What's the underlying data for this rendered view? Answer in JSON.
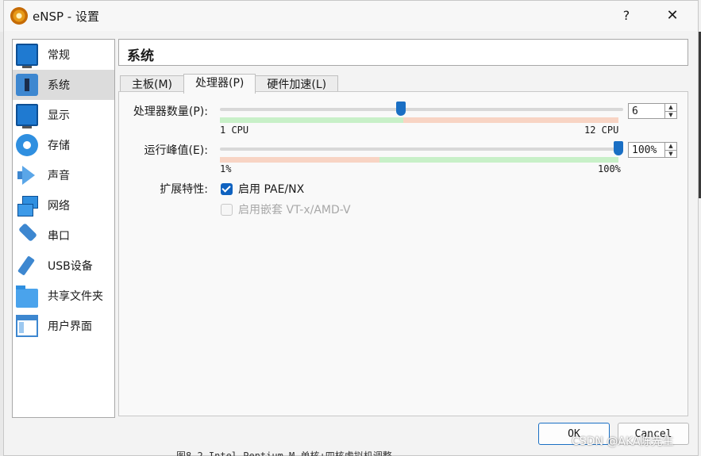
{
  "window": {
    "title": "eNSP - 设置",
    "help_label": "?",
    "close_label": "✕"
  },
  "sidebar": {
    "items": [
      {
        "label": "常规",
        "icon": "monitor-icon"
      },
      {
        "label": "系统",
        "icon": "chip-icon"
      },
      {
        "label": "显示",
        "icon": "display-icon"
      },
      {
        "label": "存储",
        "icon": "disk-icon"
      },
      {
        "label": "声音",
        "icon": "speaker-icon"
      },
      {
        "label": "网络",
        "icon": "network-icon"
      },
      {
        "label": "串口",
        "icon": "serial-icon"
      },
      {
        "label": "USB设备",
        "icon": "usb-icon"
      },
      {
        "label": "共享文件夹",
        "icon": "folder-icon"
      },
      {
        "label": "用户界面",
        "icon": "window-icon"
      }
    ],
    "active_index": 1
  },
  "main": {
    "section_title": "系统",
    "tabs": [
      {
        "label": "主板(M)"
      },
      {
        "label": "处理器(P)"
      },
      {
        "label": "硬件加速(L)"
      }
    ],
    "active_tab": 1,
    "processor": {
      "label": "处理器数量(P):",
      "value": "6",
      "min_label": "1 CPU",
      "max_label": "12 CPU",
      "min": 1,
      "max": 12,
      "current": 6
    },
    "cap": {
      "label": "运行峰值(E):",
      "value": "100%",
      "min_label": "1%",
      "max_label": "100%",
      "min": 1,
      "max": 100,
      "current": 100
    },
    "features": {
      "label": "扩展特性:",
      "pae": {
        "label": "启用 PAE/NX",
        "checked": true
      },
      "nested": {
        "label": "启用嵌套 VT-x/AMD-V",
        "checked": false,
        "enabled": false
      }
    }
  },
  "buttons": {
    "ok": "OK",
    "cancel": "Cancel"
  },
  "watermark": "CSDN @AKA陈先生",
  "background_text": "图8-2  Intel Pentium M 单核+四核虚拟机调整",
  "colors": {
    "accent": "#1a6fc4",
    "range_ok": "#c8f0c8",
    "range_warn": "#f8d4c4"
  }
}
